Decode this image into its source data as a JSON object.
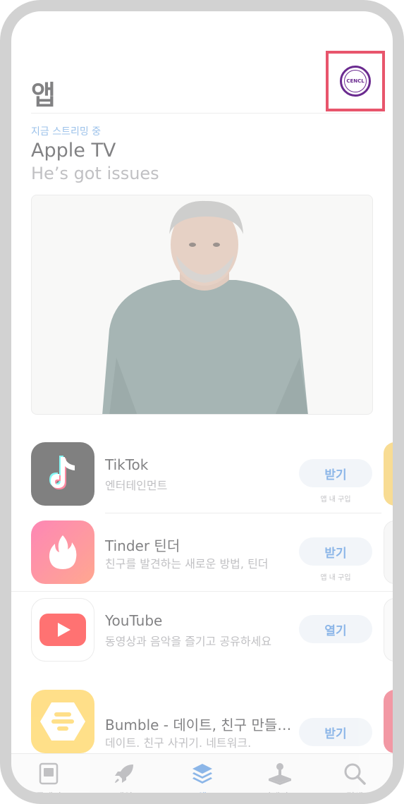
{
  "header": {
    "title": "앱"
  },
  "featured": {
    "subtitle": "지금 스트리밍 중",
    "title": "Apple TV",
    "description": "He’s got issues"
  },
  "apps": [
    {
      "name": "TikTok",
      "category": "엔터테인먼트",
      "button": "받기",
      "iap": "앱 내 구입"
    },
    {
      "name": "Tinder 틴더",
      "category": "친구를 발견하는 새로운 방법, 틴더",
      "button": "받기",
      "iap": "앱 내 구입"
    },
    {
      "name": "YouTube",
      "category": "동영상과 음악을 즐기고 공유하세요",
      "button": "열기",
      "iap": ""
    },
    {
      "name": "Bumble - 데이트, 친구 만들…",
      "category": "데이트. 친구 사귀기. 네트워크.",
      "button": "받기",
      "iap": ""
    }
  ],
  "tabs": [
    {
      "label": "투데이",
      "icon": "today-icon",
      "active": false
    },
    {
      "label": "게임",
      "icon": "rocket-icon",
      "active": false
    },
    {
      "label": "앱",
      "icon": "apps-stack-icon",
      "active": true
    },
    {
      "label": "아케이드",
      "icon": "arcade-joystick-icon",
      "active": false
    },
    {
      "label": "검색",
      "icon": "search-icon",
      "active": false
    }
  ],
  "colors": {
    "accent": "#2f7bd6",
    "highlight_border": "#e8556c"
  }
}
